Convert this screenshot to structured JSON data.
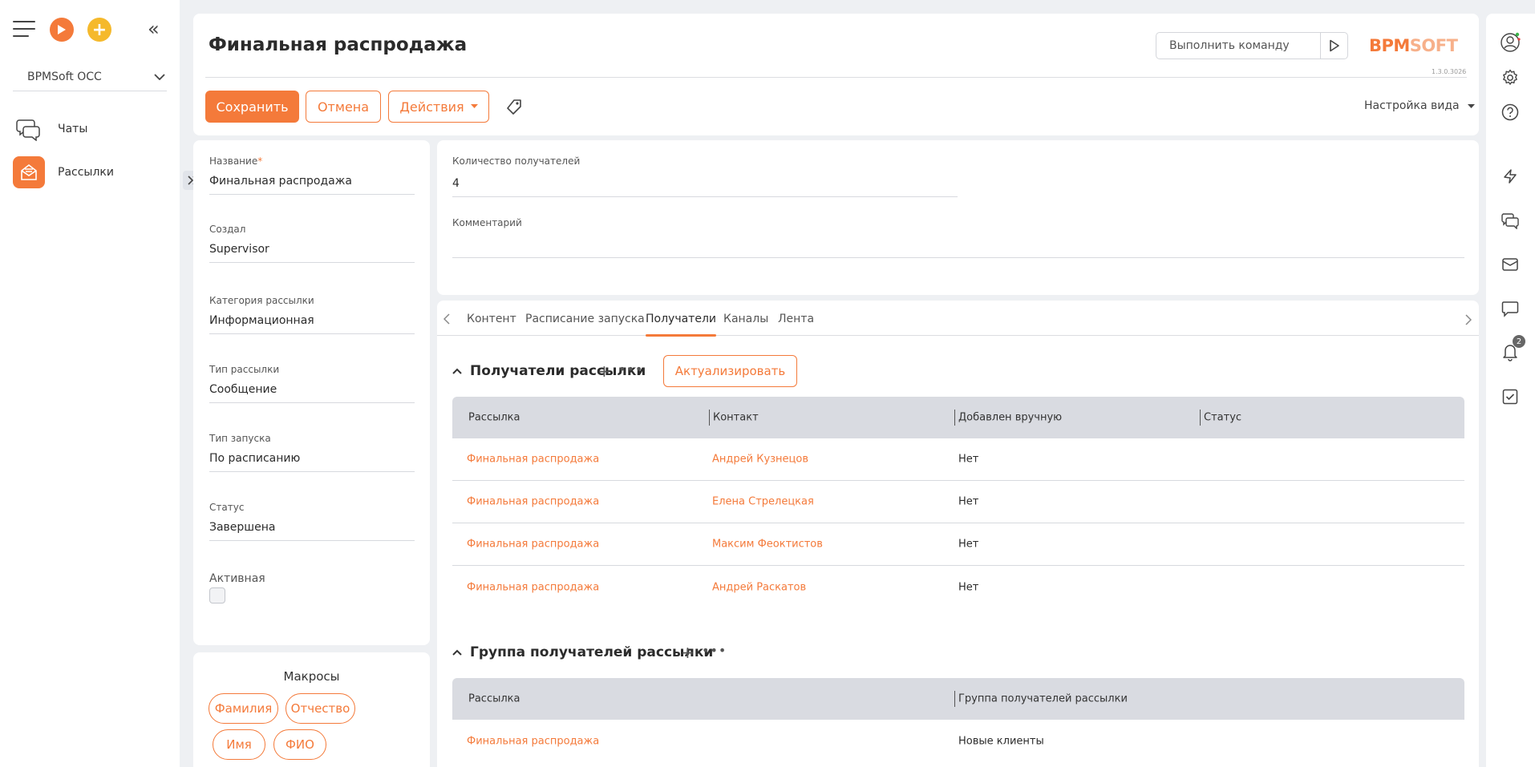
{
  "sidebar": {
    "workspace": "BPMSoft OCC",
    "items": [
      {
        "label": "Чаты",
        "icon": "chat-icon"
      },
      {
        "label": "Рассылки",
        "icon": "mailing-icon"
      }
    ]
  },
  "header": {
    "title": "Финальная распродажа",
    "command_placeholder": "Выполнить команду",
    "logo_part1": "BPM",
    "logo_part2": "SOFT",
    "version": "1.3.0.3026",
    "save": "Сохранить",
    "cancel": "Отмена",
    "actions": "Действия",
    "view_settings": "Настройка вида"
  },
  "fields": {
    "name_label": "Название",
    "name_required": "*",
    "name_value": "Финальная распродажа",
    "created_label": "Создал",
    "created_value": "Supervisor",
    "category_label": "Категория рассылки",
    "category_value": "Информационная",
    "type_label": "Тип рассылки",
    "type_value": "Сообщение",
    "launch_label": "Тип запуска",
    "launch_value": "По расписанию",
    "status_label": "Статус",
    "status_value": "Завершена",
    "active_label": "Активная",
    "active_checked": false,
    "recipients_count_label": "Количество получателей",
    "recipients_count_value": "4",
    "comment_label": "Комментарий",
    "comment_value": ""
  },
  "macros": {
    "title": "Макросы",
    "chips": [
      "Фамилия",
      "Отчество",
      "Имя",
      "ФИО"
    ]
  },
  "tabs": [
    "Контент",
    "Расписание запуска",
    "Получатели",
    "Каналы",
    "Лента"
  ],
  "active_tab": "Получатели",
  "recipients": {
    "title": "Получатели рассылки",
    "update_button": "Актуализировать",
    "columns": [
      "Рассылка",
      "Контакт",
      "Добавлен вручную",
      "Статус"
    ],
    "rows": [
      {
        "mailing": "Финальная распродажа",
        "contact": "Андрей Кузнецов",
        "manual": "Нет",
        "status": ""
      },
      {
        "mailing": "Финальная распродажа",
        "contact": "Елена Стрелецкая",
        "manual": "Нет",
        "status": ""
      },
      {
        "mailing": "Финальная распродажа",
        "contact": "Максим Феоктистов",
        "manual": "Нет",
        "status": ""
      },
      {
        "mailing": "Финальная распродажа",
        "contact": "Андрей Раскатов",
        "manual": "Нет",
        "status": ""
      }
    ]
  },
  "groups": {
    "title": "Группа получателей рассылки",
    "columns": [
      "Рассылка",
      "Группа получателей рассылки"
    ],
    "rows": [
      {
        "mailing": "Финальная распродажа",
        "group": "Новые клиенты"
      }
    ]
  },
  "rightbar": {
    "notifications_count": "2"
  },
  "colors": {
    "accent": "#f47a3a",
    "yellow": "#f5b92c"
  }
}
